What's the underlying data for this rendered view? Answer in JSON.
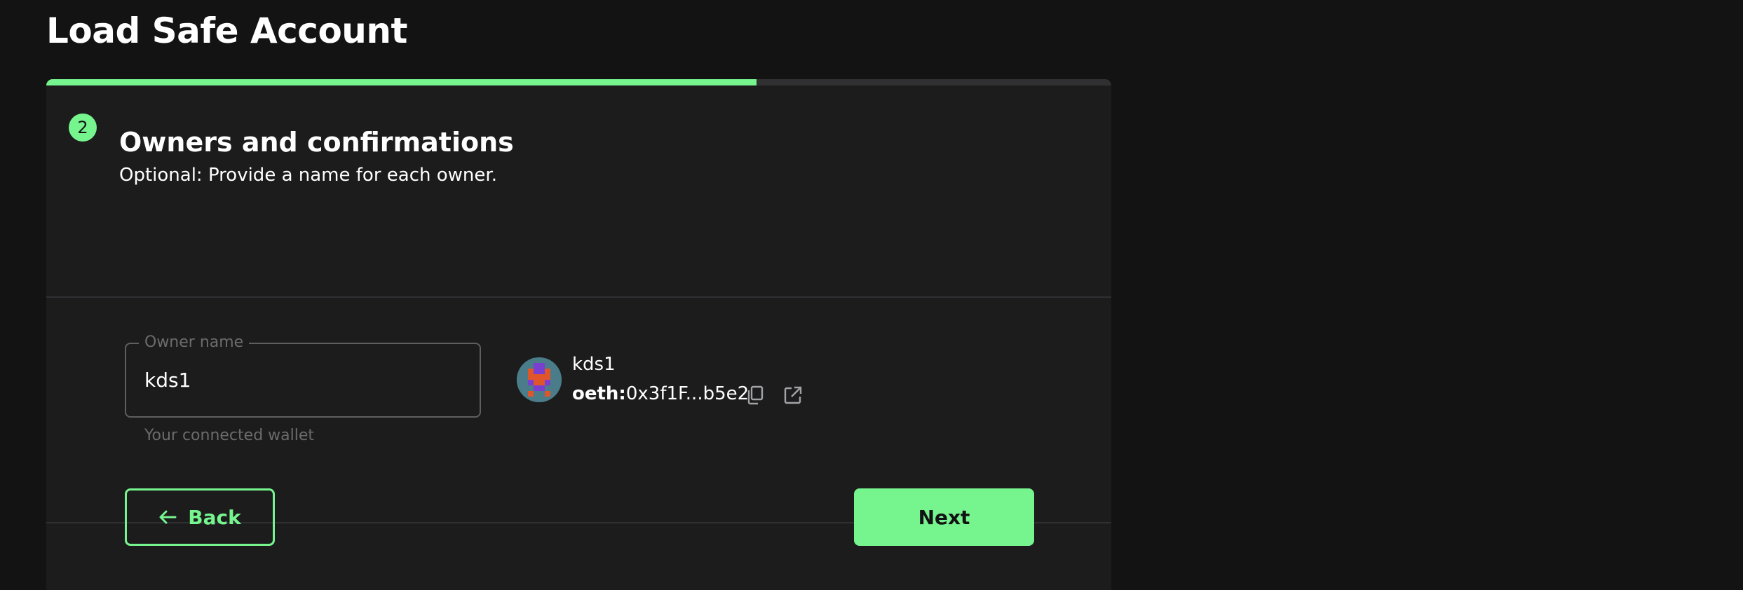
{
  "page": {
    "title": "Load Safe Account"
  },
  "progress": {
    "fraction": 0.667
  },
  "step": {
    "number": "2",
    "title": "Owners and confirmations",
    "subtitle": "Optional: Provide a name for each owner."
  },
  "owner": {
    "field_label": "Owner name",
    "field_value": "kds1",
    "helper_text": "Your connected wallet",
    "display_name": "kds1",
    "address_prefix": "oeth:",
    "address_short": "0x3f1F...b5e2",
    "copy_icon": "copy-icon",
    "link_icon": "external-link-icon"
  },
  "actions": {
    "back_label": "Back",
    "next_label": "Next"
  },
  "colors": {
    "accent": "#76f58f",
    "background": "#121312",
    "card": "#1c1c1c",
    "border": "#303033"
  }
}
